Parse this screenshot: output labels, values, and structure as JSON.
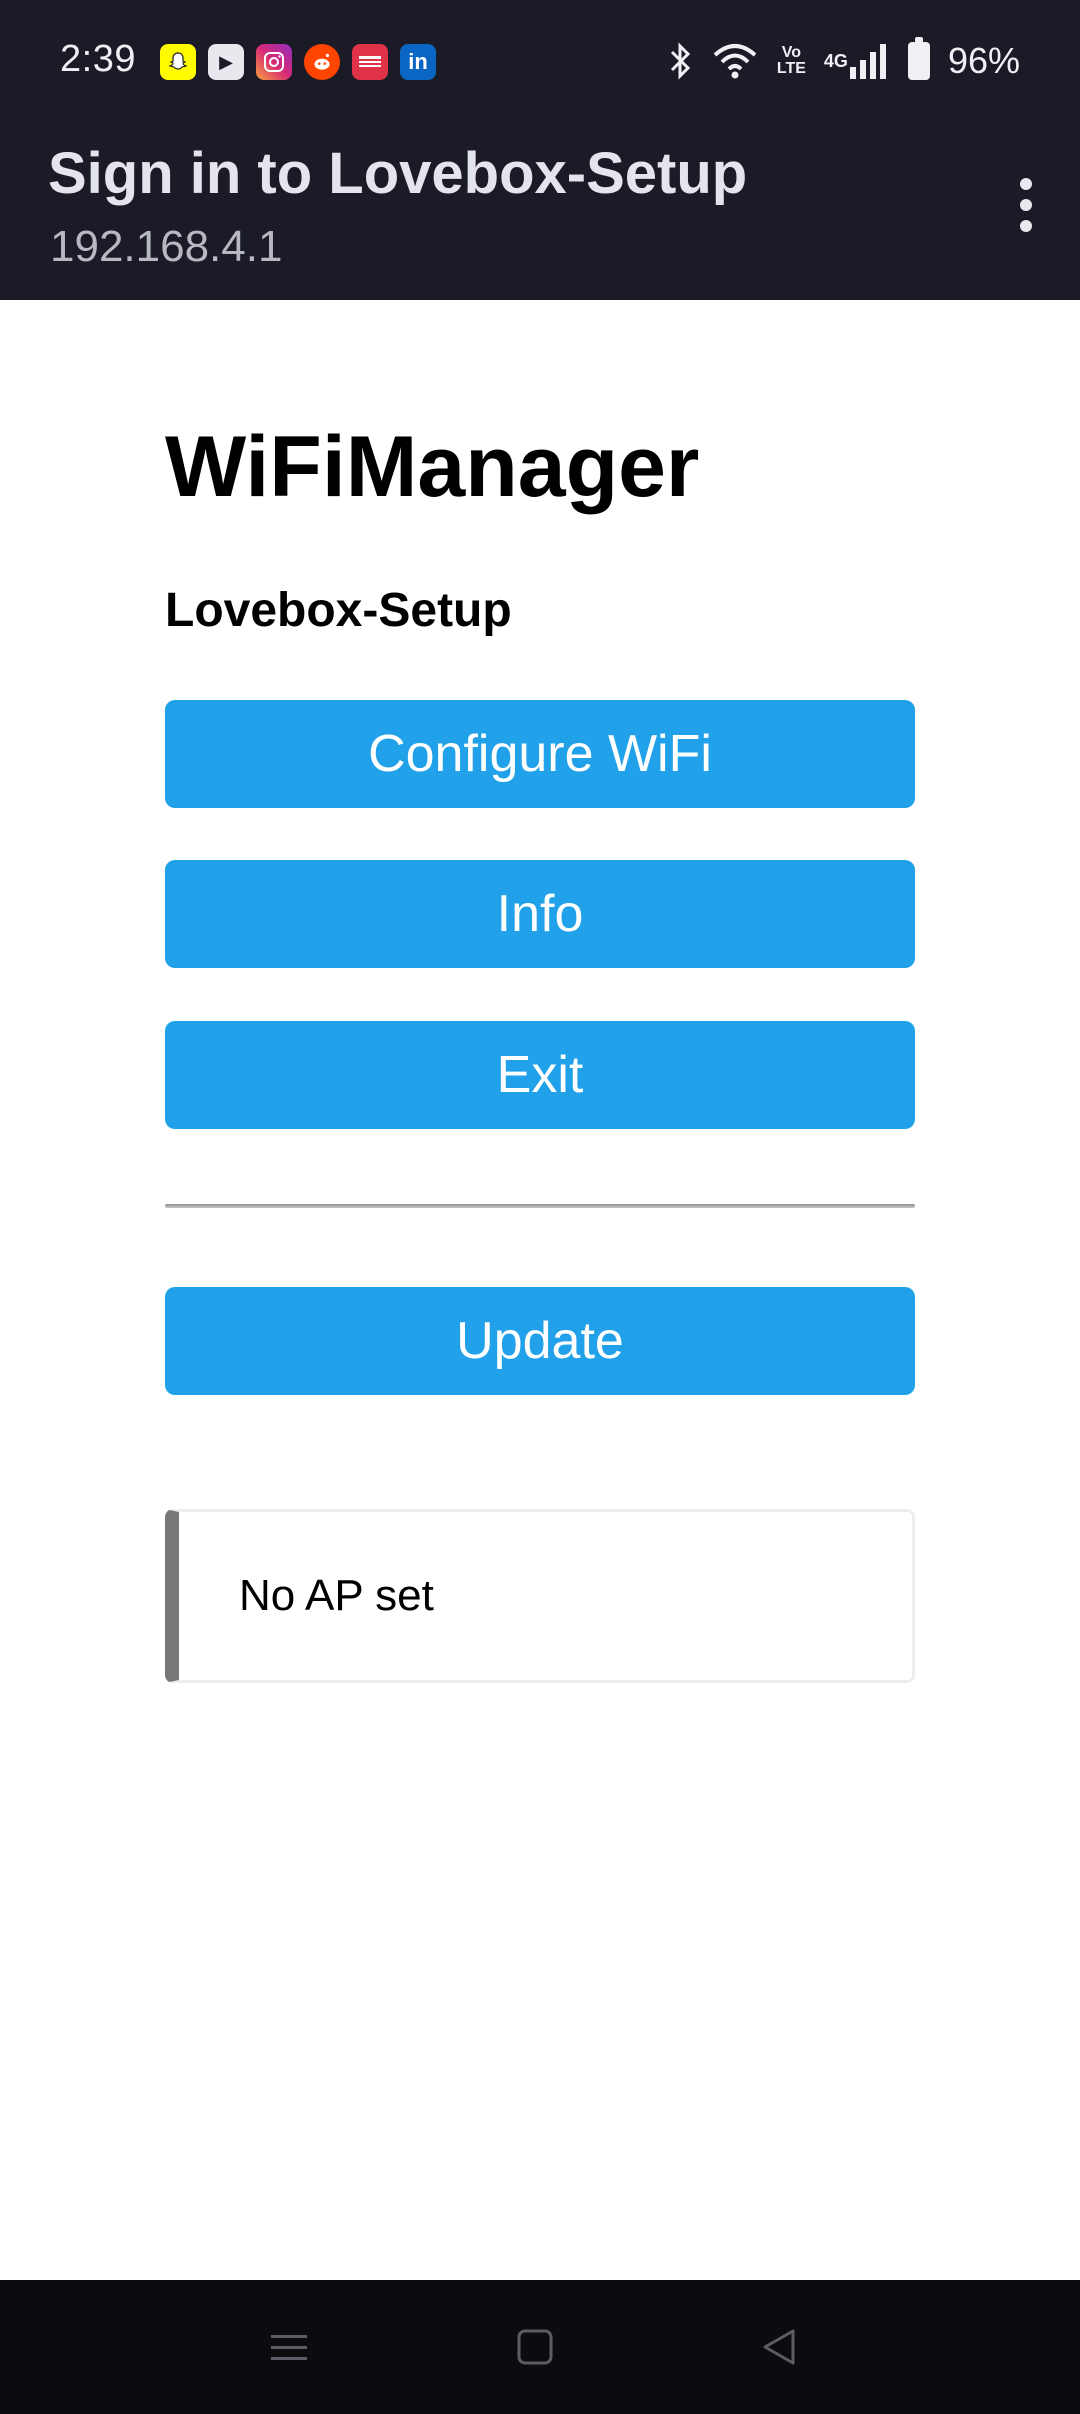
{
  "status_bar": {
    "time": "2:39",
    "notification_icons": [
      "snapchat-icon",
      "youtube-icon",
      "instagram-icon",
      "reddit-icon",
      "news-icon",
      "linkedin-icon"
    ],
    "system_icons": [
      "bluetooth-icon",
      "wifi-icon",
      "volte-icon",
      "4g-signal-icon",
      "battery-icon"
    ],
    "volte_line1": "Vo",
    "volte_line2": "LTE",
    "network": "4G",
    "battery": "96%"
  },
  "header": {
    "title": "Sign in to Lovebox-Setup",
    "url": "192.168.4.1"
  },
  "page": {
    "heading": "WiFiManager",
    "ap_name": "Lovebox-Setup",
    "buttons": {
      "configure": "Configure WiFi",
      "info": "Info",
      "exit": "Exit",
      "update": "Update"
    },
    "message": "No AP set"
  },
  "colors": {
    "header_bg": "#1a1b26",
    "button_bg": "#21a1e9",
    "button_text": "#ffffff",
    "message_border": "#777777"
  }
}
